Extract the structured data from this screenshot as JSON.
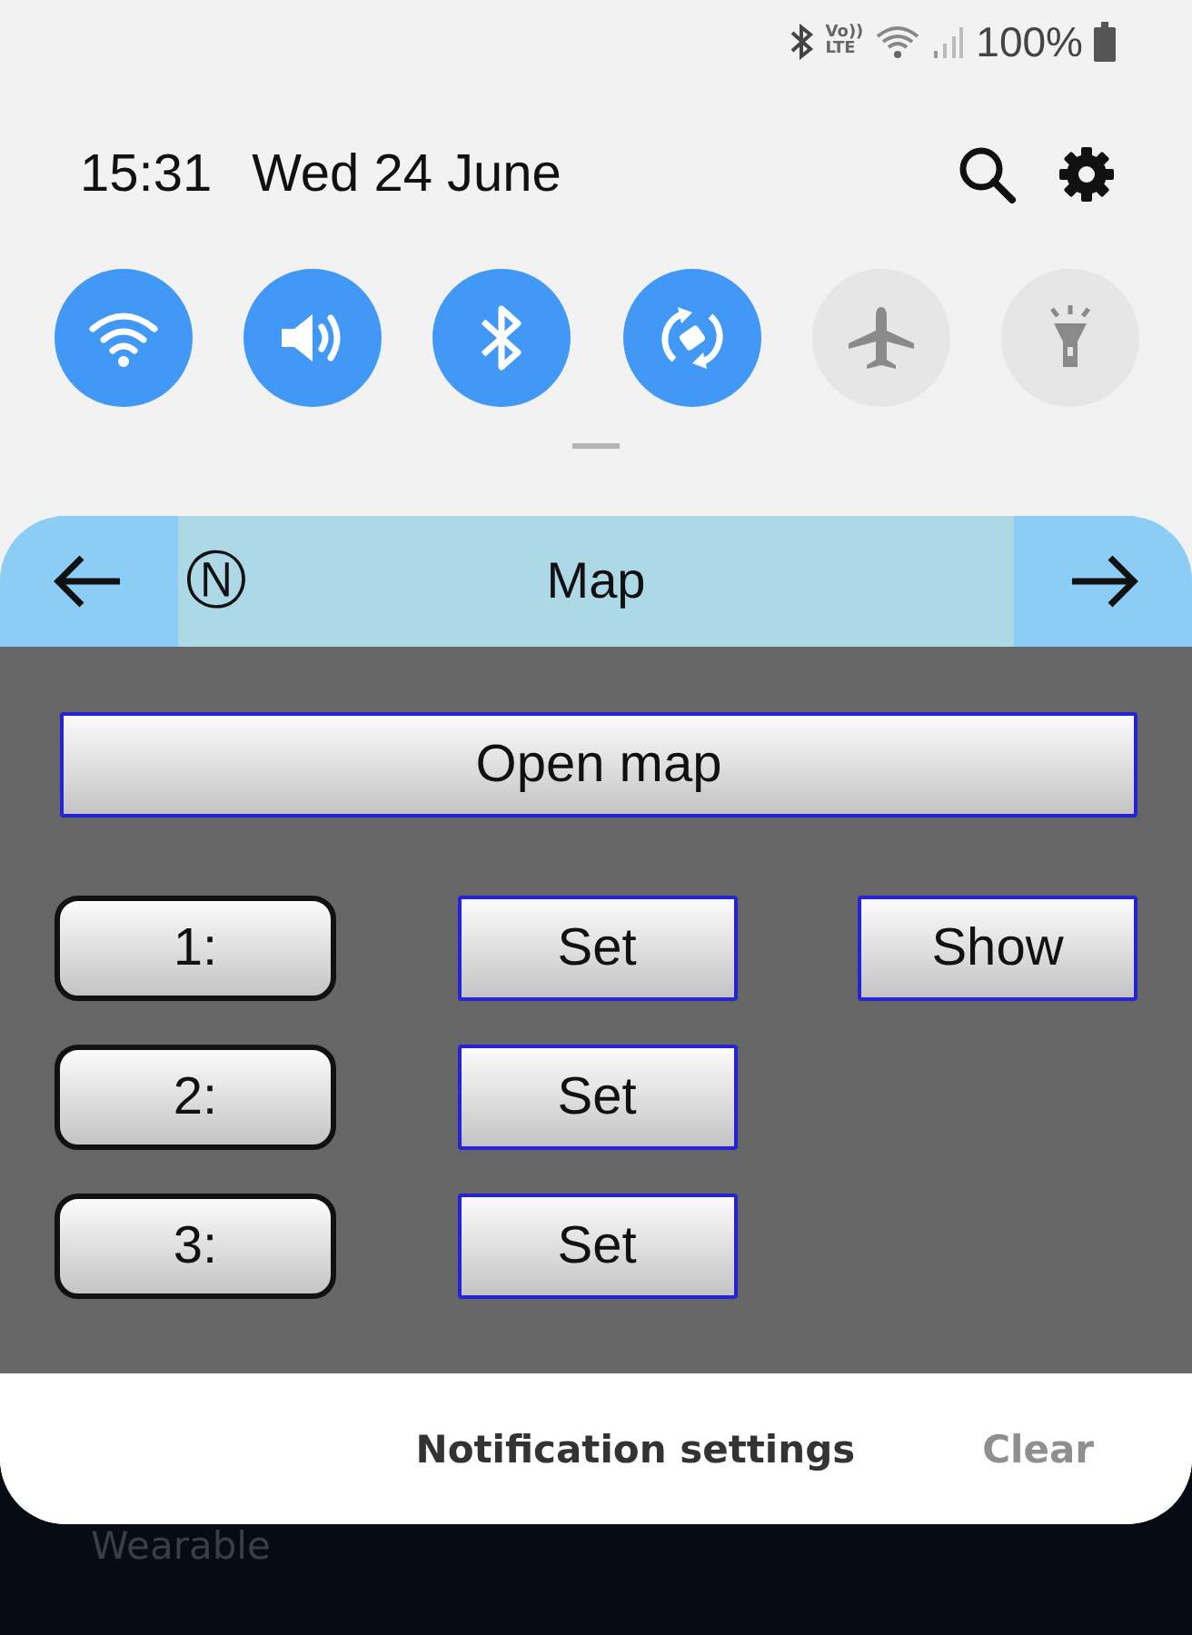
{
  "status_bar": {
    "volte": [
      "Vo))",
      "LTE"
    ],
    "battery": "100%"
  },
  "header": {
    "time": "15:31",
    "date": "Wed 24 June"
  },
  "quick_toggles": [
    {
      "kind": "wifi",
      "on": true
    },
    {
      "kind": "sound",
      "on": true
    },
    {
      "kind": "bluetooth",
      "on": true
    },
    {
      "kind": "rotate",
      "on": true
    },
    {
      "kind": "airplane",
      "on": false
    },
    {
      "kind": "flashlight",
      "on": false
    }
  ],
  "notification": {
    "app_icon": "Ⓝ",
    "title": "Map",
    "open_button": "Open map",
    "slots": [
      {
        "label": "1:",
        "set": "Set",
        "show": "Show"
      },
      {
        "label": "2:",
        "set": "Set"
      },
      {
        "label": "3:",
        "set": "Set"
      }
    ]
  },
  "footer": {
    "settings": "Notification settings",
    "clear": "Clear",
    "clear_disabled": true
  },
  "behind": {
    "label": "Wearable"
  }
}
